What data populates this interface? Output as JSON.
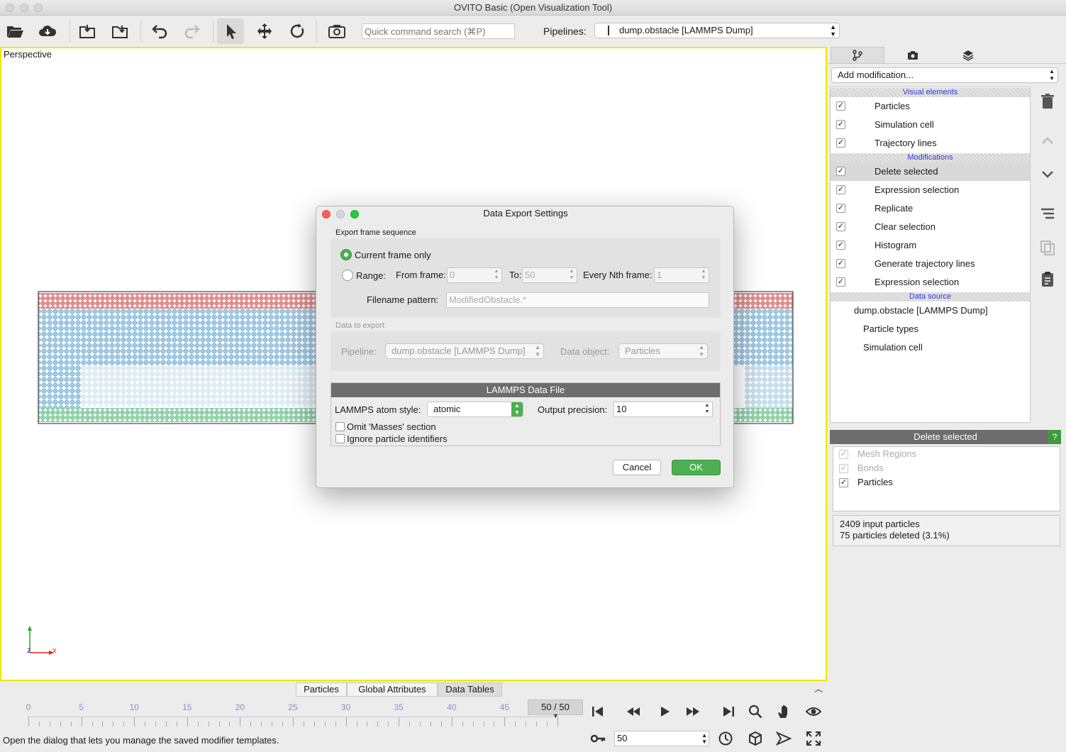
{
  "window": {
    "title": "OVITO Basic (Open Visualization Tool)"
  },
  "toolbar": {
    "search_placeholder": "Quick command search (⌘P)",
    "pipelines_label": "Pipelines:",
    "pipeline_value": "dump.obstacle [LAMMPS Dump]"
  },
  "viewport": {
    "label": "Perspective",
    "axis_x": "x",
    "axis_z": "z"
  },
  "colors": {
    "accent_yellow": "#f2e600",
    "top_particles": "#e58a8a",
    "fluid_particles": "#9ccbe8",
    "bottom_particles": "#8fd69b",
    "ok_green": "#4caf50"
  },
  "dialog": {
    "title": "Data Export Settings",
    "frame_section": "Export frame sequence",
    "current_frame": "Current frame only",
    "range": "Range:",
    "from_label": "From frame:",
    "from_value": "0",
    "to_label": "To:",
    "to_value": "50",
    "nth_label": "Every Nth frame:",
    "nth_value": "1",
    "filename_label": "Filename pattern:",
    "filename_value": "ModifiedObstacle.*",
    "data_section": "Data to export",
    "pipeline_label": "Pipeline:",
    "pipeline_value": "dump.obstacle [LAMMPS Dump]",
    "object_label": "Data object:",
    "object_value": "Particles",
    "format_header": "LAMMPS Data File",
    "atom_style_label": "LAMMPS atom style:",
    "atom_style_value": "atomic",
    "precision_label": "Output precision:",
    "precision_value": "10",
    "omit_masses": "Omit 'Masses' section",
    "ignore_ids": "Ignore particle identifiers",
    "cancel": "Cancel",
    "ok": "OK"
  },
  "right": {
    "add_modification": "Add modification...",
    "visual_header": "Visual elements",
    "visual_items": [
      "Particles",
      "Simulation cell",
      "Trajectory lines"
    ],
    "mod_header": "Modifications",
    "mod_items": [
      "Delete selected",
      "Expression selection",
      "Replicate",
      "Clear selection",
      "Histogram",
      "Generate trajectory lines",
      "Expression selection"
    ],
    "source_header": "Data source",
    "source_name": "dump.obstacle [LAMMPS Dump]",
    "source_items": [
      "Particle types",
      "Simulation cell"
    ],
    "panel_title": "Delete selected",
    "help": "?",
    "types": [
      "Mesh Regions",
      "Bonds",
      "Particles"
    ],
    "status_line1": "2409 input particles",
    "status_line2": "75 particles deleted (3.1%)"
  },
  "bottom": {
    "tabs": [
      "Particles",
      "Global Attributes",
      "Data Tables"
    ],
    "ticks": [
      "0",
      "5",
      "10",
      "15",
      "20",
      "25",
      "30",
      "35",
      "40",
      "45"
    ],
    "frame_display": "50 / 50",
    "current_frame": "50",
    "status": "Open the dialog that lets you manage the saved modifier templates."
  }
}
